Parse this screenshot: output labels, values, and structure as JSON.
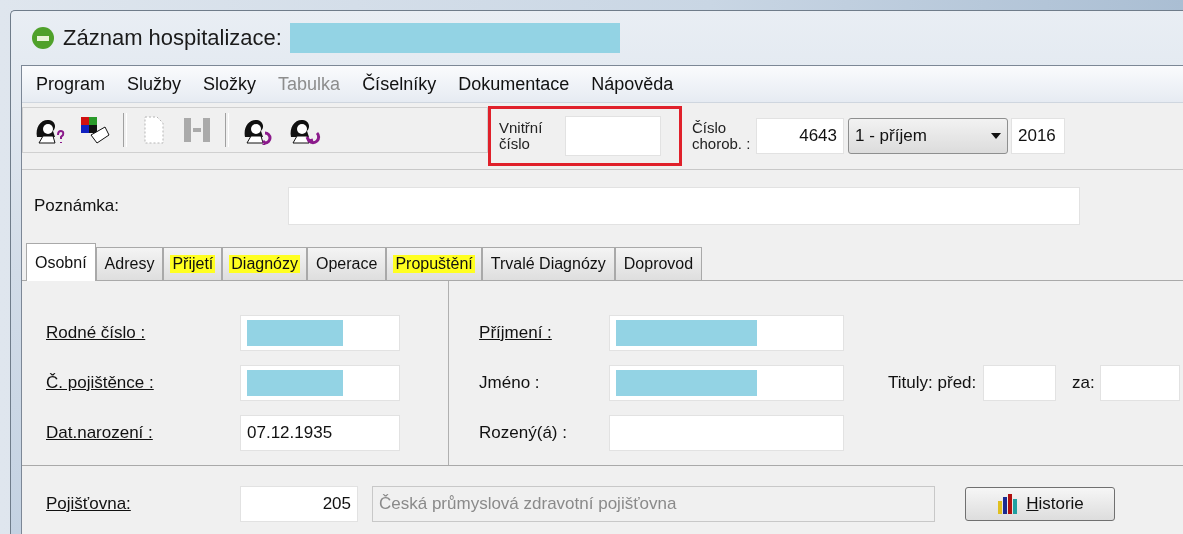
{
  "window": {
    "title": "Záznam hospitalizace:",
    "title_redacted": true
  },
  "menu": [
    {
      "label": "Program",
      "disabled": false
    },
    {
      "label": "Služby",
      "disabled": false
    },
    {
      "label": "Složky",
      "disabled": false
    },
    {
      "label": "Tabulka",
      "disabled": true
    },
    {
      "label": "Číselníky",
      "disabled": false
    },
    {
      "label": "Dokumentace",
      "disabled": false
    },
    {
      "label": "Nápověda",
      "disabled": false
    }
  ],
  "toolbar": [
    {
      "kind": "person-question",
      "disabled": false
    },
    {
      "kind": "color-card",
      "disabled": false
    },
    {
      "kind": "separator"
    },
    {
      "kind": "page",
      "disabled": true
    },
    {
      "kind": "columns",
      "disabled": true
    },
    {
      "kind": "separator"
    },
    {
      "kind": "person-arrow",
      "disabled": false
    },
    {
      "kind": "person-undo",
      "disabled": false
    }
  ],
  "header": {
    "internal_number": {
      "label": "Vnitřní číslo",
      "highlighted": true
    },
    "case_number": {
      "label": "Číslo chorob. :",
      "value": "4643"
    },
    "case_type": {
      "value": "1 - příjem"
    },
    "year": {
      "value": "2016"
    }
  },
  "note": {
    "label": "Poznámka:"
  },
  "tabs": [
    {
      "label": "Osobní",
      "selected": true,
      "highlighted": false
    },
    {
      "label": "Adresy",
      "selected": false,
      "highlighted": false
    },
    {
      "label": "Přijetí",
      "selected": false,
      "highlighted": true
    },
    {
      "label": "Diagnózy",
      "selected": false,
      "highlighted": true
    },
    {
      "label": "Operace",
      "selected": false,
      "highlighted": false
    },
    {
      "label": "Propuštění",
      "selected": false,
      "highlighted": true
    },
    {
      "label": "Trvalé Diagnózy",
      "selected": false,
      "highlighted": false
    },
    {
      "label": "Doprovod",
      "selected": false,
      "highlighted": false
    }
  ],
  "left_fields": [
    {
      "label": "Rodné číslo :",
      "underlined": true,
      "redacted": true
    },
    {
      "label": "Č. pojištěnce :",
      "underlined": true,
      "redacted": true
    },
    {
      "label": "Dat.narození :",
      "underlined": true,
      "redacted": false,
      "value": "07.12.1935"
    }
  ],
  "right_fields": [
    {
      "label": "Příjmení :",
      "underlined": true,
      "redacted": true
    },
    {
      "label": "Jméno :",
      "underlined": false,
      "redacted": true
    },
    {
      "label": "Rozený(á) :",
      "underlined": false,
      "redacted": false
    }
  ],
  "titles": {
    "label": "Tituly: před:",
    "after_label": "za:"
  },
  "insurer": {
    "label": "Pojišťovna:",
    "code": "205",
    "name": "Česká průmyslová zdravotní pojišťovna",
    "name_disabled": true
  },
  "history_button": {
    "label": "Historie"
  }
}
